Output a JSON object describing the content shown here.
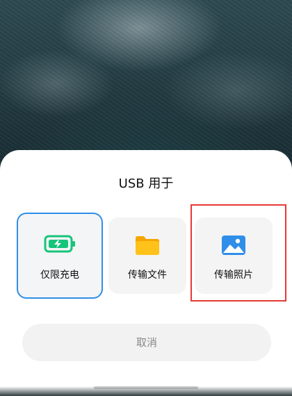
{
  "dialog": {
    "title": "USB 用于",
    "cancel_label": "取消"
  },
  "options": [
    {
      "label": "仅限充电",
      "icon": "battery-charging-icon",
      "selected": true,
      "accent": "#2f8ee8",
      "icon_color": "#16c47a"
    },
    {
      "label": "传输文件",
      "icon": "folder-icon",
      "selected": false,
      "icon_color": "#f7b500"
    },
    {
      "label": "传输照片",
      "icon": "image-icon",
      "selected": false,
      "icon_color": "#2f8ee8",
      "annotated": true
    }
  ],
  "colors": {
    "highlight_box": "#e53935",
    "selected_border": "#2f8ee8"
  }
}
